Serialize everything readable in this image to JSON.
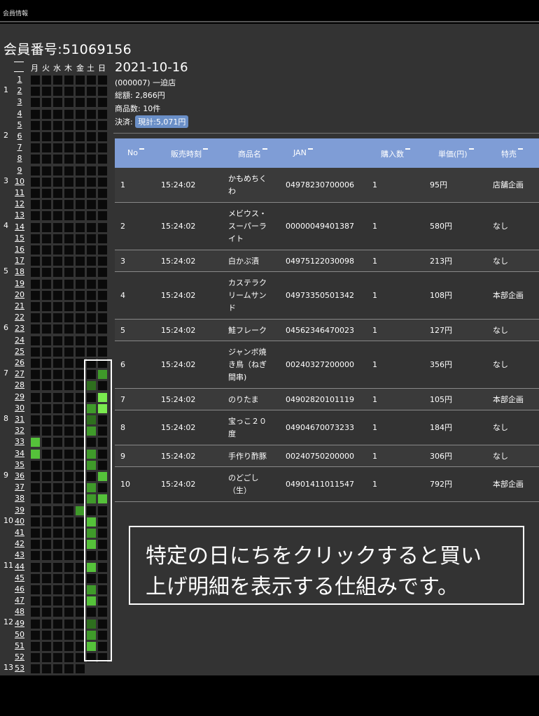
{
  "window": {
    "title": "会員情報"
  },
  "member": {
    "label": "会員番号:51069156"
  },
  "calendar": {
    "days": [
      "月",
      "火",
      "水",
      "木",
      "金",
      "土",
      "日"
    ],
    "months": [
      "1",
      "2",
      "3",
      "4",
      "5",
      "6",
      "7",
      "8",
      "9",
      "10",
      "11",
      "12",
      "13"
    ],
    "weeks": [
      "1",
      "2",
      "3",
      "4",
      "5",
      "6",
      "7",
      "8",
      "9",
      "10",
      "11",
      "12",
      "13",
      "14",
      "15",
      "16",
      "17",
      "18",
      "19",
      "20",
      "21",
      "22",
      "23",
      "24",
      "25",
      "26",
      "27",
      "28",
      "29",
      "30",
      "31",
      "32",
      "33",
      "34",
      "35",
      "36",
      "37",
      "38",
      "39",
      "40",
      "41",
      "42",
      "43",
      "44",
      "45",
      "46",
      "47",
      "48",
      "49",
      "50",
      "51",
      "52",
      "53"
    ],
    "purchases": [
      {
        "week": 27,
        "day": 6,
        "level": 2
      },
      {
        "week": 28,
        "day": 5,
        "level": 1
      },
      {
        "week": 28,
        "day": 6,
        "level": 0
      },
      {
        "week": 29,
        "day": 6,
        "level": 4
      },
      {
        "week": 30,
        "day": 5,
        "level": 2
      },
      {
        "week": 30,
        "day": 6,
        "level": 4
      },
      {
        "week": 31,
        "day": 5,
        "level": 1
      },
      {
        "week": 32,
        "day": 5,
        "level": 2
      },
      {
        "week": 33,
        "day": 0,
        "level": 3
      },
      {
        "week": 34,
        "day": 0,
        "level": 3
      },
      {
        "week": 34,
        "day": 5,
        "level": 2
      },
      {
        "week": 35,
        "day": 5,
        "level": 2
      },
      {
        "week": 36,
        "day": 6,
        "level": 3
      },
      {
        "week": 37,
        "day": 5,
        "level": 2
      },
      {
        "week": 38,
        "day": 5,
        "level": 2
      },
      {
        "week": 38,
        "day": 6,
        "level": 3
      },
      {
        "week": 39,
        "day": 4,
        "level": 2
      },
      {
        "week": 40,
        "day": 5,
        "level": 3
      },
      {
        "week": 41,
        "day": 5,
        "level": 2
      },
      {
        "week": 42,
        "day": 5,
        "level": 3
      },
      {
        "week": 44,
        "day": 5,
        "level": 3
      },
      {
        "week": 46,
        "day": 5,
        "level": 2
      },
      {
        "week": 47,
        "day": 5,
        "level": 3
      },
      {
        "week": 49,
        "day": 5,
        "level": 1
      },
      {
        "week": 50,
        "day": 5,
        "level": 2
      },
      {
        "week": 51,
        "day": 5,
        "level": 3
      }
    ]
  },
  "detail": {
    "date": "2021-10-16",
    "store": "(000007) 一迫店",
    "total_label": "総額: 2,866円",
    "count_label": "商品数: 10件",
    "payment_label": "決済:",
    "payment_value": "現計:5,071円"
  },
  "table": {
    "headers": [
      "No",
      "販売時刻",
      "商品名",
      "JAN",
      "購入数",
      "単価(円)",
      "特売"
    ],
    "rows": [
      {
        "no": "1",
        "time": "15:24:02",
        "name": [
          "かもめちく",
          "わ"
        ],
        "jan": "04978230700006",
        "qty": "1",
        "price": "95円",
        "sale": "店舗企画"
      },
      {
        "no": "2",
        "time": "15:24:02",
        "name": [
          "メビウス・",
          "スーパーラ",
          "イト"
        ],
        "jan": "00000049401387",
        "qty": "1",
        "price": "580円",
        "sale": "なし"
      },
      {
        "no": "3",
        "time": "15:24:02",
        "name": [
          "白かぶ漬"
        ],
        "jan": "04975122030098",
        "qty": "1",
        "price": "213円",
        "sale": "なし"
      },
      {
        "no": "4",
        "time": "15:24:02",
        "name": [
          "カステラク",
          "リームサン",
          "ド"
        ],
        "jan": "04973350501342",
        "qty": "1",
        "price": "108円",
        "sale": "本部企画"
      },
      {
        "no": "5",
        "time": "15:24:02",
        "name": [
          "鮭フレーク"
        ],
        "jan": "04562346470023",
        "qty": "1",
        "price": "127円",
        "sale": "なし"
      },
      {
        "no": "6",
        "time": "15:24:02",
        "name": [
          "ジャンボ焼",
          "き鳥（ねぎ",
          "間串)"
        ],
        "jan": "00240327200000",
        "qty": "1",
        "price": "356円",
        "sale": "なし"
      },
      {
        "no": "7",
        "time": "15:24:02",
        "name": [
          "のりたま"
        ],
        "jan": "04902820101119",
        "qty": "1",
        "price": "105円",
        "sale": "本部企画"
      },
      {
        "no": "8",
        "time": "15:24:02",
        "name": [
          "宝っこ２０",
          "度"
        ],
        "jan": "04904670073233",
        "qty": "1",
        "price": "184円",
        "sale": "なし"
      },
      {
        "no": "9",
        "time": "15:24:02",
        "name": [
          "手作り酢豚"
        ],
        "jan": "00240750200000",
        "qty": "1",
        "price": "306円",
        "sale": "なし"
      },
      {
        "no": "10",
        "time": "15:24:02",
        "name": [
          "のどごし",
          "（生）"
        ],
        "jan": "04901411011547",
        "qty": "1",
        "price": "792円",
        "sale": "本部企画"
      }
    ]
  },
  "callout": {
    "line1": "特定の日にちをクリックすると買い",
    "line2": "上げ明細を表示する仕組みです。"
  },
  "colors": {
    "level1": "#2e6f1e",
    "level2": "#3f9a2a",
    "level3": "#55c23a",
    "level4": "#7aea4f",
    "header": "#7f9dd6",
    "pill": "#6a8fc7"
  }
}
